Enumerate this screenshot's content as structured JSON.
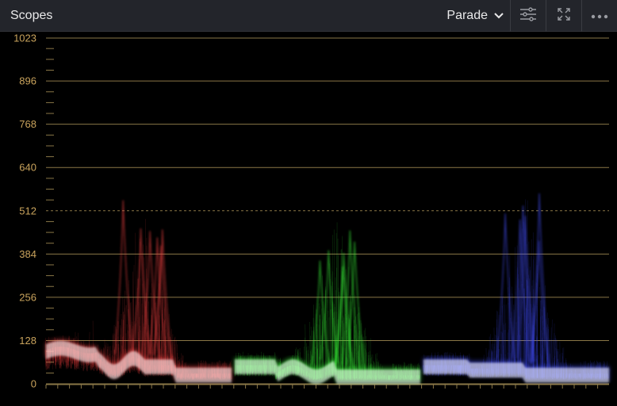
{
  "header": {
    "title": "Scopes",
    "mode_label": "Parade",
    "icons": [
      "chevron-down-icon",
      "sliders-icon",
      "expand-icon",
      "more-icon"
    ]
  },
  "scope": {
    "scale_labels": [
      "0",
      "128",
      "256",
      "384",
      "512",
      "640",
      "768",
      "896",
      "1023"
    ],
    "scale_values": [
      0,
      128,
      256,
      384,
      512,
      640,
      768,
      896,
      1023
    ],
    "midline_value": 512,
    "channels": [
      "red",
      "green",
      "blue"
    ],
    "colors": {
      "label": "#c9a35c",
      "gridline": "#8a7747",
      "red": "#ff4646",
      "green": "#3cff3c",
      "blue": "#4650ff",
      "header_bg": "#23252b"
    }
  }
}
